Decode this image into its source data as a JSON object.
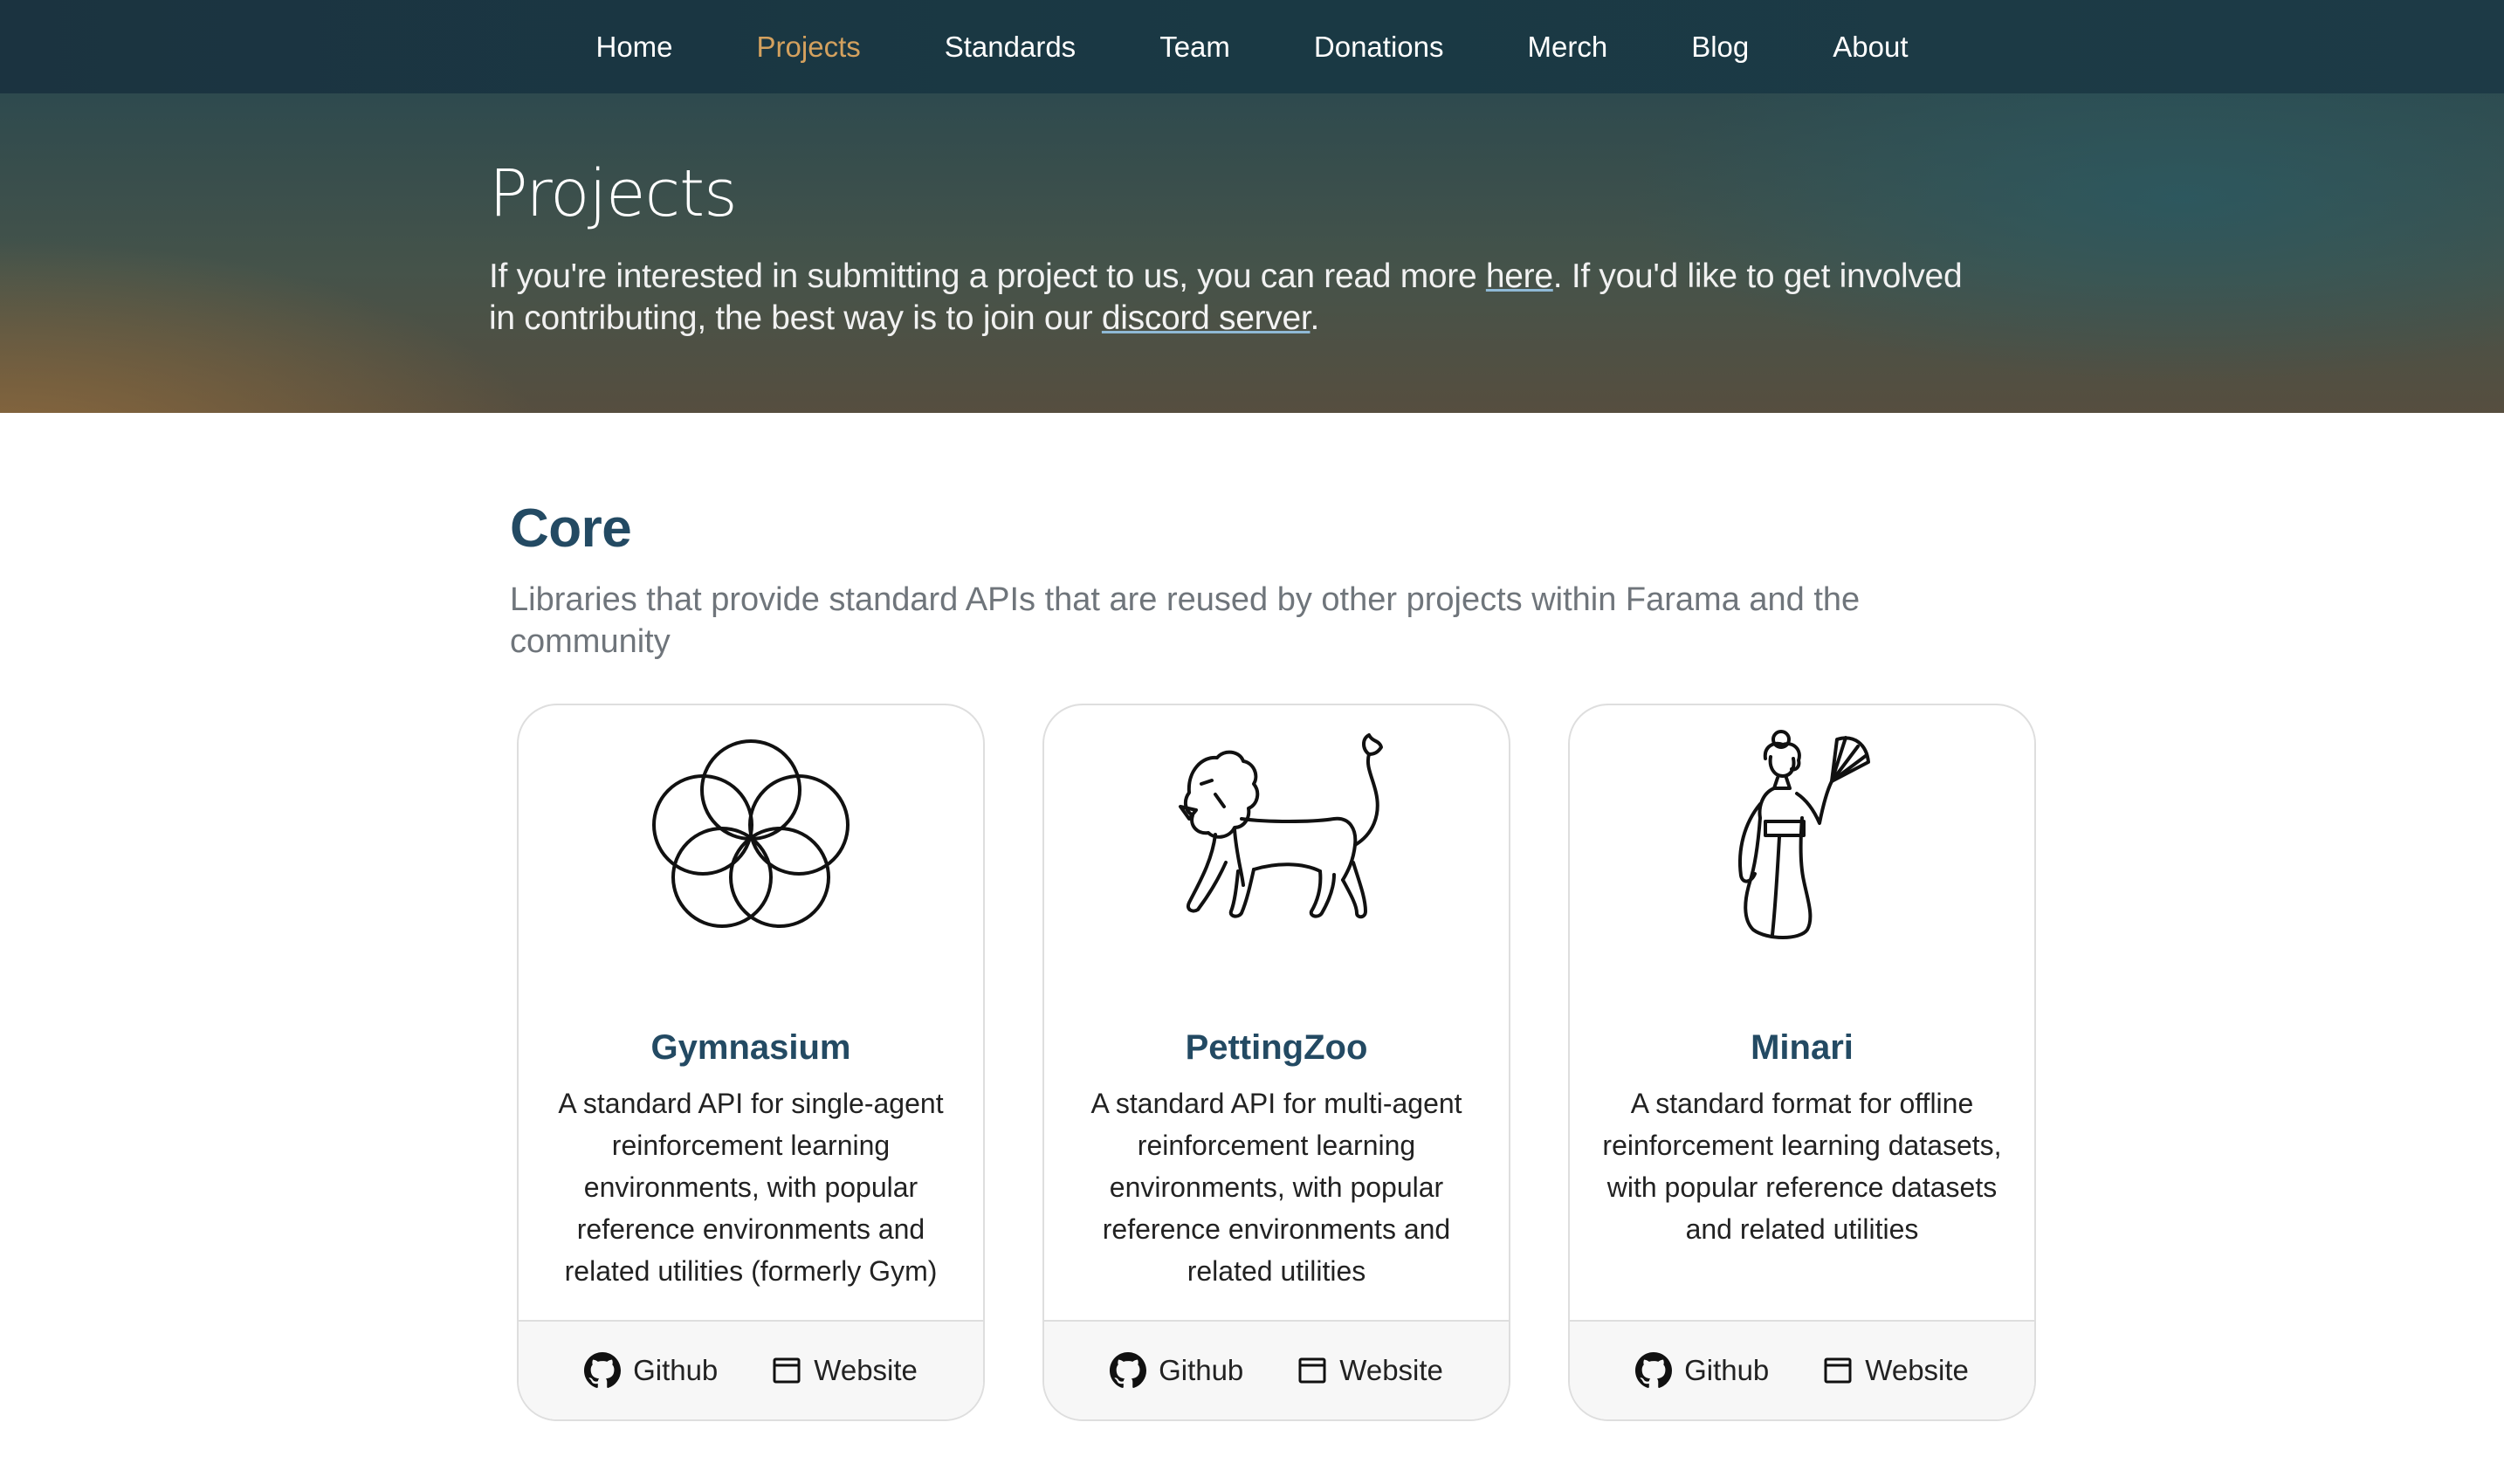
{
  "nav": {
    "items": [
      {
        "label": "Home"
      },
      {
        "label": "Projects",
        "active": true
      },
      {
        "label": "Standards"
      },
      {
        "label": "Team"
      },
      {
        "label": "Donations"
      },
      {
        "label": "Merch"
      },
      {
        "label": "Blog"
      },
      {
        "label": "About"
      }
    ],
    "active_color": "#d4a15e"
  },
  "hero": {
    "title": "Projects",
    "text1": "If you're interested in submitting a project to us, you can read more ",
    "link_here": "here",
    "text2": ". If you'd like to get involved in contributing, the best way is to join our ",
    "link_discord": "discord server",
    "text3": "."
  },
  "core": {
    "heading": "Core",
    "subtitle": "Libraries that provide standard APIs that are reused by other projects within Farama and the community",
    "cards": [
      {
        "icon": "gymnasium-logo-icon",
        "title": "Gymnasium",
        "description": "A standard API for single-agent reinforcement learning environments, with popular reference environments and related utilities (formerly Gym)",
        "github_label": "Github",
        "website_label": "Website"
      },
      {
        "icon": "pettingzoo-logo-icon",
        "title": "PettingZoo",
        "description": "A standard API for multi-agent reinforcement learning environments, with popular reference environments and related utilities",
        "github_label": "Github",
        "website_label": "Website"
      },
      {
        "icon": "minari-logo-icon",
        "title": "Minari",
        "description": "A standard format for offline reinforcement learning datasets, with popular reference datasets and related utilities",
        "github_label": "Github",
        "website_label": "Website"
      }
    ]
  },
  "colors": {
    "heading": "#234a63",
    "nav_bg": "#1b3340"
  }
}
